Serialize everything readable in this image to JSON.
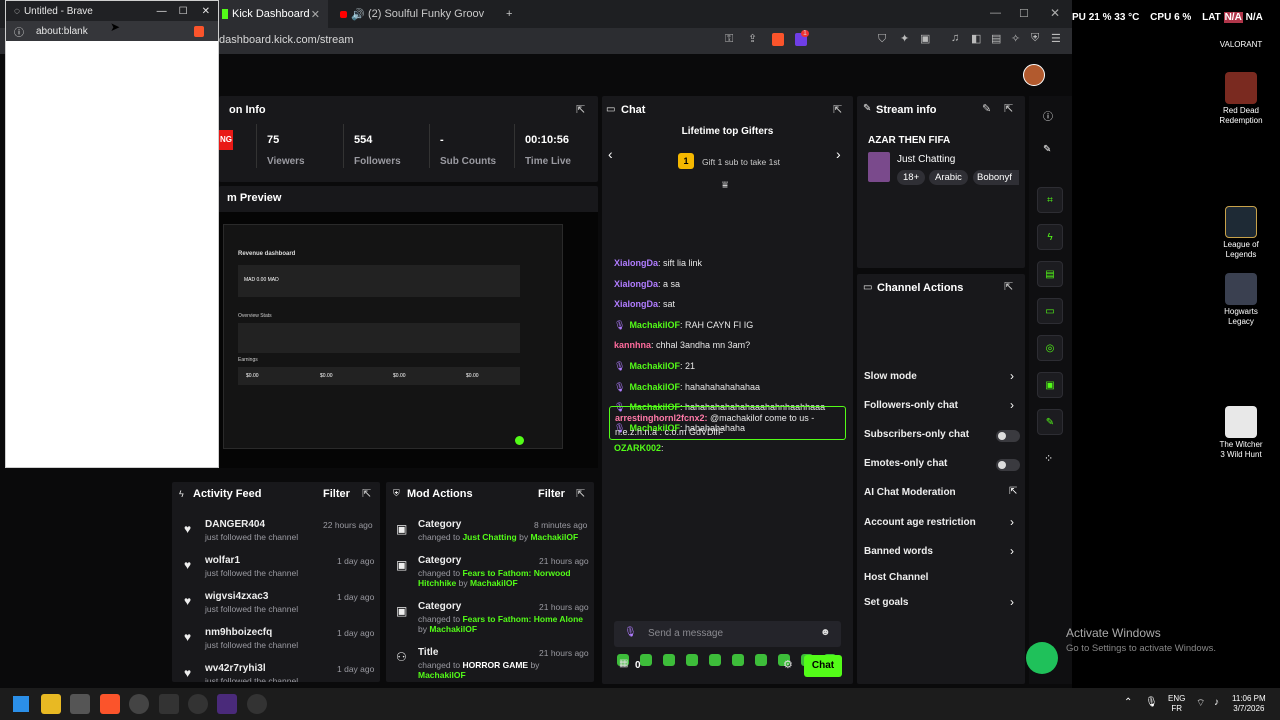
{
  "browser": {
    "tabs": [
      {
        "label": "Kick Dashboard"
      },
      {
        "label": "(2) Soulful Funky Groovin' – Retr"
      }
    ],
    "new_tab": "+",
    "url": "dashboard.kick.com/stream",
    "ext_badge": "1"
  },
  "popup": {
    "title": "Untitled - Brave",
    "url": "about:blank"
  },
  "session": {
    "title": "on Info",
    "live_badge": "NG",
    "stats": [
      {
        "value": "75",
        "label": "Viewers"
      },
      {
        "value": "554",
        "label": "Followers"
      },
      {
        "value": "-",
        "label": "Sub Counts"
      },
      {
        "value": "00:10:56",
        "label": "Time Live"
      }
    ]
  },
  "preview": {
    "title": "m Preview",
    "inner_title": "Revenue dashboard",
    "inner_value": "MAD 0.00 MAD",
    "inner_section": "Overview Stats",
    "inner_earnings": "Earnings",
    "earn_values": [
      "$0.00",
      "$0.00",
      "$0.00",
      "$0.00"
    ]
  },
  "chat": {
    "title": "Chat",
    "top_gifters_title": "Lifetime top Gifters",
    "gifter_rank": "1",
    "gifter_text": "Gift 1 sub to take 1st",
    "messages": [
      {
        "user": "XialongDa",
        "text": ": sift lia link",
        "color": "#b07cff"
      },
      {
        "user": "XialongDa",
        "text": ": a sa",
        "color": "#b07cff"
      },
      {
        "user": "XialongDa",
        "text": ": sat",
        "color": "#b07cff"
      },
      {
        "user": "MachakilOF",
        "text": ": RAH CAYN FI IG",
        "color": "#53fc18",
        "mod": true
      },
      {
        "user": "kannhna",
        "text": ": chhal 3andha mn 3am?",
        "color": "#ff6b9d"
      },
      {
        "user": "MachakilOF",
        "text": ": 21",
        "color": "#53fc18",
        "mod": true
      },
      {
        "user": "MachakilOF",
        "text": ": hahahahahahahaa",
        "color": "#53fc18",
        "mod": true
      },
      {
        "user": "MachakilOF",
        "text": ": hahahahahahahaaahahnhaahhaaa",
        "color": "#53fc18",
        "mod": true
      },
      {
        "user": "MachakilOF",
        "text": ": hahahahahaha",
        "color": "#53fc18",
        "mod": true
      },
      {
        "user": "OZARK002",
        "text": ":",
        "color": "#53fc18"
      }
    ],
    "highlight": {
      "user": "arrestinghornl2fcnx2:",
      "text": " @machakilof come to us - n.e.z.h.n.a . c.o.m GdVDlfF"
    },
    "placeholder": "Send a message",
    "points": "0",
    "send_label": "Chat"
  },
  "stream_info": {
    "title": "Stream info",
    "stream_title": "AZAR THEN FIFA",
    "category": "Just Chatting",
    "tags": [
      "18+",
      "Arabic",
      "Bobonyf"
    ]
  },
  "channel_actions": {
    "title": "Channel Actions",
    "items": [
      {
        "label": "Slow mode",
        "control": "chevron"
      },
      {
        "label": "Followers-only chat",
        "control": "chevron"
      },
      {
        "label": "Subscribers-only chat",
        "control": "toggle"
      },
      {
        "label": "Emotes-only chat",
        "control": "toggle"
      },
      {
        "label": "AI Chat Moderation",
        "control": "external"
      },
      {
        "label": "Account age restriction",
        "control": "chevron"
      },
      {
        "label": "Banned words",
        "control": "chevron"
      },
      {
        "label": "Host Channel",
        "control": "none"
      },
      {
        "label": "Set goals",
        "control": "chevron"
      }
    ]
  },
  "activity": {
    "title": "Activity Feed",
    "filter": "Filter",
    "items": [
      {
        "name": "DANGER404",
        "sub": "just followed the channel",
        "time": "22 hours ago"
      },
      {
        "name": "wolfar1",
        "sub": "just followed the channel",
        "time": "1 day ago"
      },
      {
        "name": "wigvsi4zxac3",
        "sub": "just followed the channel",
        "time": "1 day ago"
      },
      {
        "name": "nm9hboizecfq",
        "sub": "just followed the channel",
        "time": "1 day ago"
      },
      {
        "name": "wv42r7ryhi3l",
        "sub": "just followed the channel",
        "time": "1 day ago"
      }
    ]
  },
  "mod": {
    "title": "Mod Actions",
    "filter": "Filter",
    "items": [
      {
        "head": "Category",
        "time": "8 minutes ago",
        "pre": "changed to ",
        "value": "Just Chatting",
        "by": " by ",
        "user": "MachakilOF"
      },
      {
        "head": "Category",
        "time": "21 hours ago",
        "pre": "changed to ",
        "value": "Fears to Fathom: Norwood Hitchhike",
        "by": " by ",
        "user": "MachakilOF"
      },
      {
        "head": "Category",
        "time": "21 hours ago",
        "pre": "changed to ",
        "value": "Fears to Fathom: Home Alone",
        "by": " by ",
        "user": "MachakilOF"
      },
      {
        "head": "Title",
        "time": "21 hours ago",
        "pre": "changed to ",
        "value": "HORROR GAME",
        "by": " by ",
        "user": "MachakilOF"
      }
    ]
  },
  "overlay": {
    "cpu_prefix": "PU",
    "cpu_val": "21 %",
    "temp": "33 °C",
    "cpu_label": "CPU",
    "cpu_pct": "6 %",
    "lat_label": "LAT",
    "lat1": "N/A",
    "lat2": "N/A"
  },
  "desktop": [
    {
      "label": "VALORANT"
    },
    {
      "label": "Red Dead Redemption"
    },
    {
      "label": "League of Legends"
    },
    {
      "label": "Hogwarts Legacy"
    },
    {
      "label": "The Witcher 3 Wild Hunt"
    }
  ],
  "watermark": {
    "line1": "Activate Windows",
    "line2": "Go to Settings to activate Windows."
  },
  "taskbar": {
    "lang1": "ENG",
    "lang2": "FR",
    "time": "11:06 PM",
    "date": "3/7/2026"
  },
  "colors": {
    "accent": "#53fc18",
    "panel": "#18181b",
    "bg": "#0a0a0b"
  }
}
